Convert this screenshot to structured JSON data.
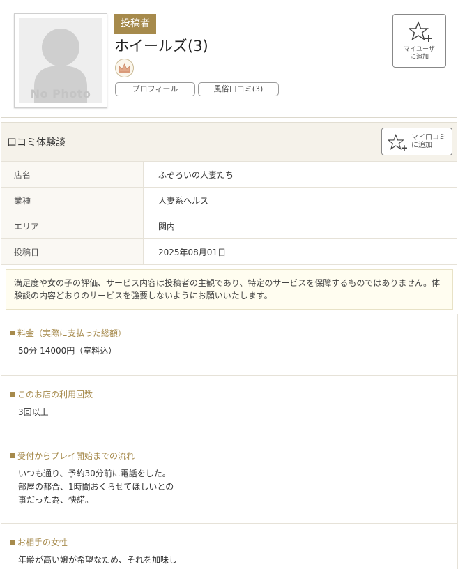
{
  "profile": {
    "no_photo_text": "No Photo",
    "role_badge": "投稿者",
    "username": "ホイールズ(3)",
    "rank_icon": "crown-icon",
    "profile_button": "プロフィール",
    "reviews_button": "風俗口コミ(3)",
    "my_user_button": [
      "マイユーザ",
      "に追加"
    ]
  },
  "section": {
    "title": "口コミ体験談",
    "my_kuchikomi_button": [
      "マイ口コミ",
      "に追加"
    ]
  },
  "info": {
    "rows": [
      {
        "label": "店名",
        "value": "ふぞろいの人妻たち"
      },
      {
        "label": "業種",
        "value": "人妻系ヘルス"
      },
      {
        "label": "エリア",
        "value": "関内"
      },
      {
        "label": "投稿日",
        "value": "2025年08月01日"
      }
    ]
  },
  "notice": "満足度や女の子の評価、サービス内容は投稿者の主観であり、特定のサービスを保障するものではありません。体験談の内容どおりのサービスを強要しないようにお願いいたします。",
  "review": {
    "price": {
      "label": "料金（実際に支払った総額）",
      "text": "50分 14000円（室料込）"
    },
    "visits": {
      "label": "このお店の利用回数",
      "text": "3回以上"
    },
    "flow": {
      "label": "受付からプレイ開始までの流れ",
      "text": "いつも通り、予約30分前に電話をした。\n部屋の都合、1時間おくらせてほしいとの\n事だった為、快諾。"
    },
    "partner": {
      "label": "お相手の女性",
      "text": "年齢が高い嬢が希望なため、それを加味し"
    }
  },
  "colors": {
    "accent": "#a68a4c",
    "header_bg": "#f5f2ea",
    "notice_bg": "#fffdf0"
  }
}
